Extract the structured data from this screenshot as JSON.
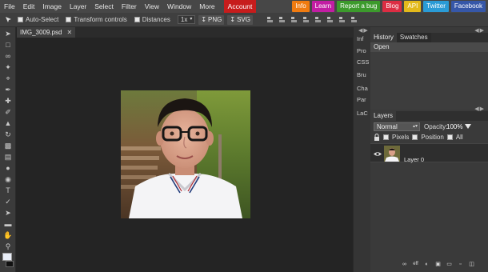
{
  "menubar": {
    "items": [
      "File",
      "Edit",
      "Image",
      "Layer",
      "Select",
      "Filter",
      "View",
      "Window",
      "More"
    ],
    "account": "Account",
    "links": [
      {
        "label": "Info",
        "color": "#f07b10"
      },
      {
        "label": "Learn",
        "color": "#c21da3"
      },
      {
        "label": "Report a bug",
        "color": "#3c9a2c"
      },
      {
        "label": "Blog",
        "color": "#dc2d43"
      },
      {
        "label": "API",
        "color": "#e3b91b"
      },
      {
        "label": "Twitter",
        "color": "#2a9bd6"
      },
      {
        "label": "Facebook",
        "color": "#3657a8"
      }
    ]
  },
  "options": {
    "auto_select": "Auto-Select",
    "transform_controls": "Transform controls",
    "distances": "Distances",
    "zoom": "1x",
    "png": "PNG",
    "svg": "SVG"
  },
  "document": {
    "tab_title": "IMG_3009.psd",
    "close_glyph": "✕"
  },
  "collapsed_panels": [
    "Inf",
    "Pro",
    "CSS",
    "Bru",
    "Cha",
    "Par",
    "LaC"
  ],
  "history": {
    "tabs": [
      "History",
      "Swatches"
    ],
    "entries": [
      "Open"
    ]
  },
  "layers": {
    "title": "Layers",
    "blend_mode": "Normal",
    "opacity_label": "Opacity:",
    "opacity_value": "100%",
    "lock_options": [
      "Pixels",
      "Position",
      "All"
    ],
    "layer_list": [
      {
        "name": "Layer 0"
      }
    ],
    "footer_icons": [
      "link-icon",
      "effects-icon",
      "adjustment-icon",
      "mask-icon",
      "folder-icon",
      "new-layer-icon",
      "trash-icon"
    ]
  },
  "colors": {
    "accent_account": "#c71c1c",
    "foreground_swatch": "#e9eef8",
    "background_swatch": "#111111"
  }
}
